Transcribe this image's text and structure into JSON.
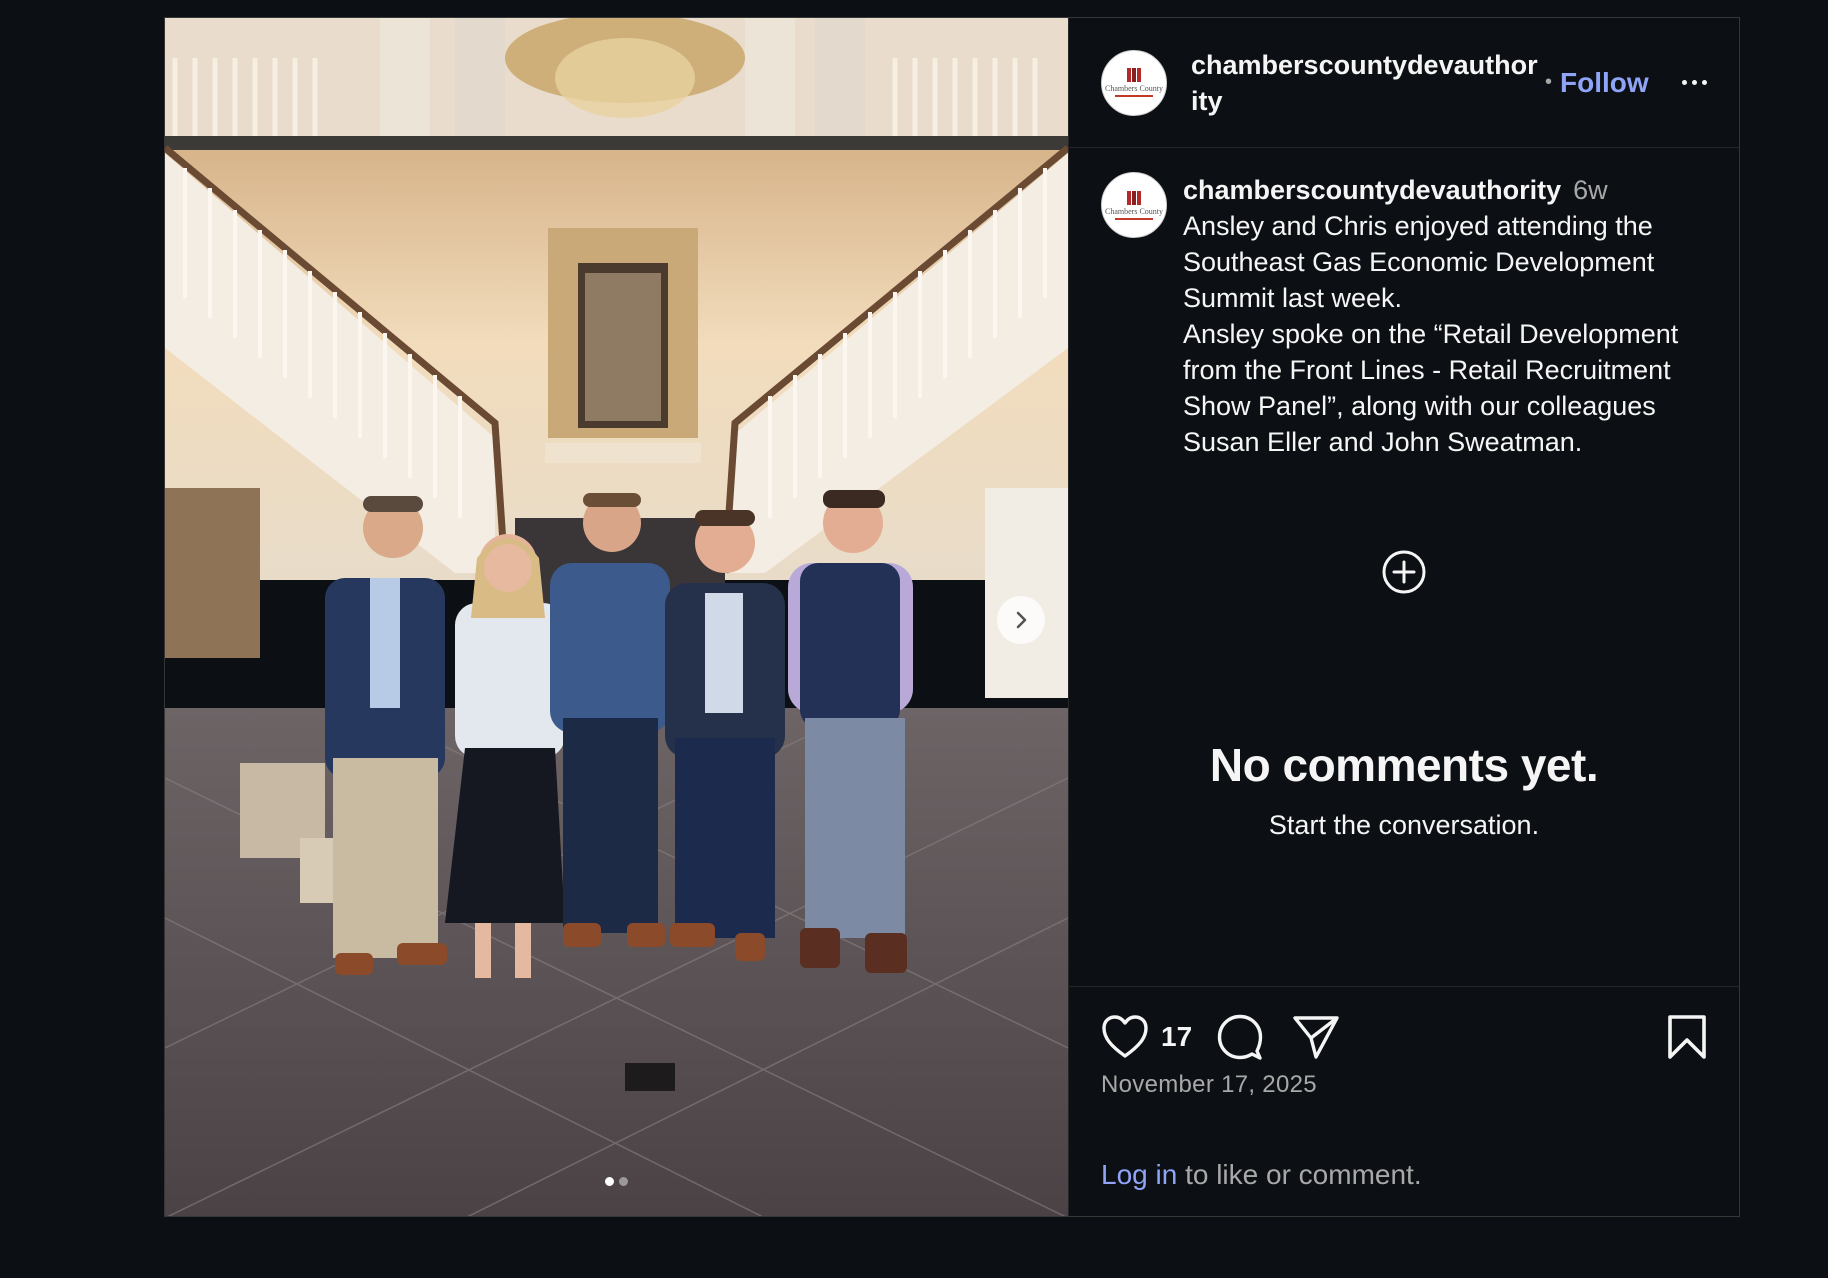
{
  "header": {
    "username": "chamberscountydevauthority",
    "separator": "•",
    "follow_label": "Follow",
    "more_icon": "more-horizontal-icon"
  },
  "avatar": {
    "logo_text": "Chambers County"
  },
  "caption": {
    "username": "chamberscountydevauthority",
    "time": "6w",
    "text": "Ansley and Chris enjoyed attending the Southeast Gas Economic Development Summit last week.\nAnsley spoke on the “Retail Development from the Front Lines - Retail Recruitment Show Panel”, along with our colleagues Susan Eller and John Sweatman."
  },
  "comments": {
    "empty_title": "No comments yet.",
    "empty_subtitle": "Start the conversation."
  },
  "actions": {
    "like_count": "17",
    "date": "November 17, 2025",
    "login_link": "Log in",
    "login_suffix": " to like or comment."
  },
  "carousel": {
    "slides": 2,
    "active_index": 0
  },
  "colors": {
    "background": "#0c1014",
    "link": "#8fa4f7",
    "secondary_text": "#a8a8a8"
  }
}
